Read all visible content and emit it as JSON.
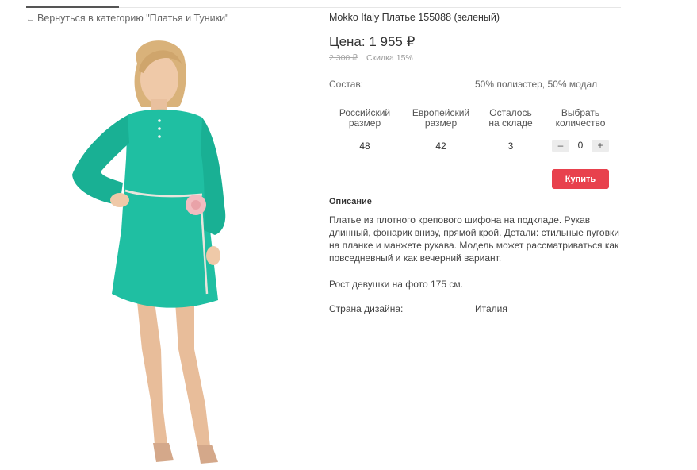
{
  "nav": {
    "back_arrow": "←",
    "back_label": "Вернуться в категорию \"Платья и Туники\""
  },
  "product": {
    "image_alt": "Модель в зелёном платье",
    "title": "Mokko Italy Платье 155088 (зеленый)",
    "price": "Цена: 1 955 ₽",
    "old_price": "2 300 ₽",
    "discount": "Скидка 15%",
    "composition_label": "Состав:",
    "composition_value": "50% полиэстер, 50% модал"
  },
  "size_table": {
    "headers": {
      "ru_size": "Российский размер",
      "eu_size": "Европейский размер",
      "stock": "Осталось на складе",
      "quantity": "Выбрать количество"
    },
    "row": {
      "ru_size": "48",
      "eu_size": "42",
      "stock": "3",
      "quantity": "0"
    },
    "minus_label": "–",
    "plus_label": "+"
  },
  "buy_button": "Купить",
  "description": {
    "heading": "Описание",
    "text": "Платье из плотного крепового шифона на подкладе. Рукав длинный, фонарик внизу, прямой крой. Детали: стильные пуговки на планке и манжете рукава. Модель может рассматриваться как повседневный и как вечерний вариант.",
    "model_height": "Рост девушки на фото 175 см."
  },
  "design_country": {
    "label": "Страна дизайна:",
    "value": "Италия"
  },
  "colors": {
    "buy_button": "#e8414d",
    "dress": "#1fbfa2"
  }
}
